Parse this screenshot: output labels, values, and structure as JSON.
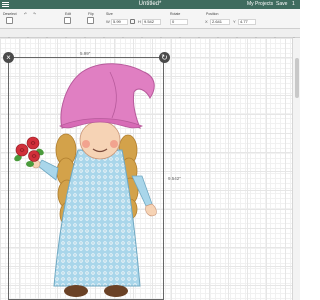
{
  "header": {
    "title": "Untitled*",
    "my_projects": "My Projects",
    "save": "Save",
    "more": "1"
  },
  "toolbar": {
    "labels": {
      "deselect": "Deselect",
      "edit": "Edit",
      "flip": "Flip",
      "size": "Size",
      "rotate": "Rotate",
      "position": "Position"
    },
    "size_w_tag": "W",
    "size_w": "5.99",
    "size_h_tag": "H",
    "size_h": "9.542",
    "rotate_value": "0",
    "position_x_tag": "X",
    "position_x": "2.641",
    "position_y_tag": "Y",
    "position_y": "4.77"
  },
  "canvas": {
    "width_label": "5.99\"",
    "height_label": "9.542\""
  },
  "colors": {
    "header_bg": "#3f6c5f",
    "hat": "#e07fc2",
    "dress": "#a9d6ea",
    "hair": "#d3a24a",
    "flower": "#d12f3a",
    "leaf": "#4b9a3c"
  },
  "icons": [
    "menu-icon",
    "undo-icon",
    "redo-icon",
    "close-icon",
    "rotate-icon",
    "lock-icon"
  ]
}
